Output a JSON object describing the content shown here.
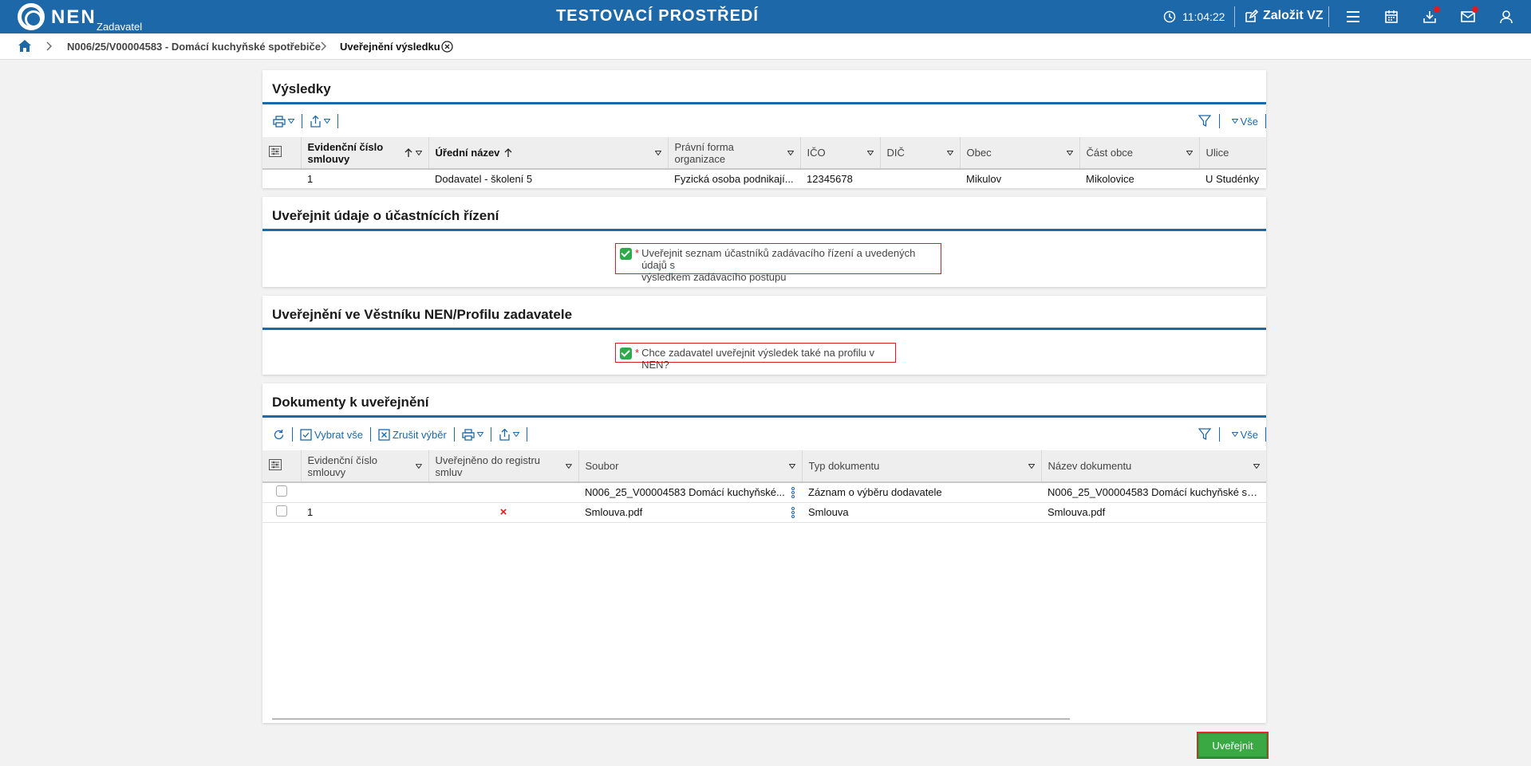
{
  "topbar": {
    "brand": "NEN",
    "brand_sub": "Zadavatel",
    "env_title": "TESTOVACÍ PROSTŘEDÍ",
    "clock": "11:04:22",
    "new_vz": "Založit VZ"
  },
  "breadcrumb": {
    "items": [
      "N006/25/V00004583 - Domácí kuchyňské spotřebiče",
      "Uveřejnění výsledku"
    ]
  },
  "results": {
    "title": "Výsledky",
    "filter_all": "Vše",
    "columns": [
      "Evidenční číslo smlouvy",
      "Úřední název",
      "Právní forma organizace",
      "IČO",
      "DIČ",
      "Obec",
      "Část obce",
      "Ulice"
    ],
    "rows": [
      [
        "1",
        "Dodavatel - školení 5",
        "Fyzická osoba podnikají...",
        "12345678",
        "",
        "Mikulov",
        "Mikolovice",
        "U Studénky"
      ]
    ]
  },
  "participants": {
    "title": "Uveřejnit údaje o účastnících řízení",
    "required_mark": "*",
    "checkbox_label_line1": "Uveřejnit seznam účastníků zadávacího řízení a uvedených údajů s",
    "checkbox_label_line2": "výsledkem zadávacího postupu"
  },
  "bulletin": {
    "title": "Uveřejnění ve Věstníku NEN/Profilu zadavatele",
    "required_mark": "*",
    "checkbox_label": "Chce zadavatel uveřejnit výsledek také na profilu v NEN?"
  },
  "documents": {
    "title": "Dokumenty k uveřejnění",
    "toolbar": {
      "select_all": "Vybrat vše",
      "cancel_selection": "Zrušit výběr"
    },
    "filter_all": "Vše",
    "columns": [
      "Evidenční číslo smlouvy",
      "Uveřejněno do registru smluv",
      "Soubor",
      "Typ dokumentu",
      "Název dokumentu"
    ],
    "rows": [
      {
        "evidence": "",
        "registry": "",
        "file": "N006_25_V00004583 Domácí kuchyňské...",
        "type": "Záznam o výběru dodavatele",
        "name": "N006_25_V00004583 Domácí kuchyňské sp..."
      },
      {
        "evidence": "1",
        "registry": "×",
        "file": "Smlouva.pdf",
        "type": "Smlouva",
        "name": "Smlouva.pdf"
      }
    ]
  },
  "actions": {
    "publish": "Uveřejnit"
  },
  "colors": {
    "primary": "#1d68a8",
    "success": "#3aa843",
    "error": "#e01b22"
  }
}
